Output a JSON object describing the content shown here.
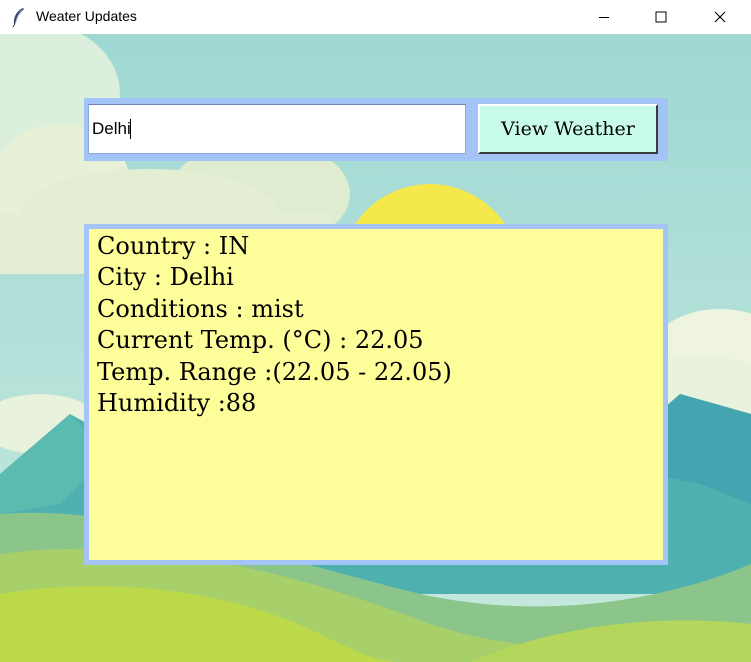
{
  "window": {
    "title": "Weater Updates"
  },
  "search": {
    "city_value": "Delhi",
    "button_label": "View Weather"
  },
  "result": {
    "lines": [
      "Country : IN",
      "City : Delhi",
      "Conditions : mist",
      "Current Temp. (°C) : 22.05",
      "Temp. Range :(22.05 - 22.05)",
      "Humidity :88"
    ]
  },
  "colors": {
    "sky": "#a8dcd5",
    "sun": "#f5e84a",
    "mountains": "#4fb0b0",
    "hills": "#9bd15c",
    "frame": "#a4c3f7",
    "result_bg": "#fdfd9a",
    "button_bg": "#c8fbe9"
  },
  "icons": {
    "app": "feather-icon",
    "minimize": "minimize-icon",
    "maximize": "maximize-icon",
    "close": "close-icon"
  }
}
